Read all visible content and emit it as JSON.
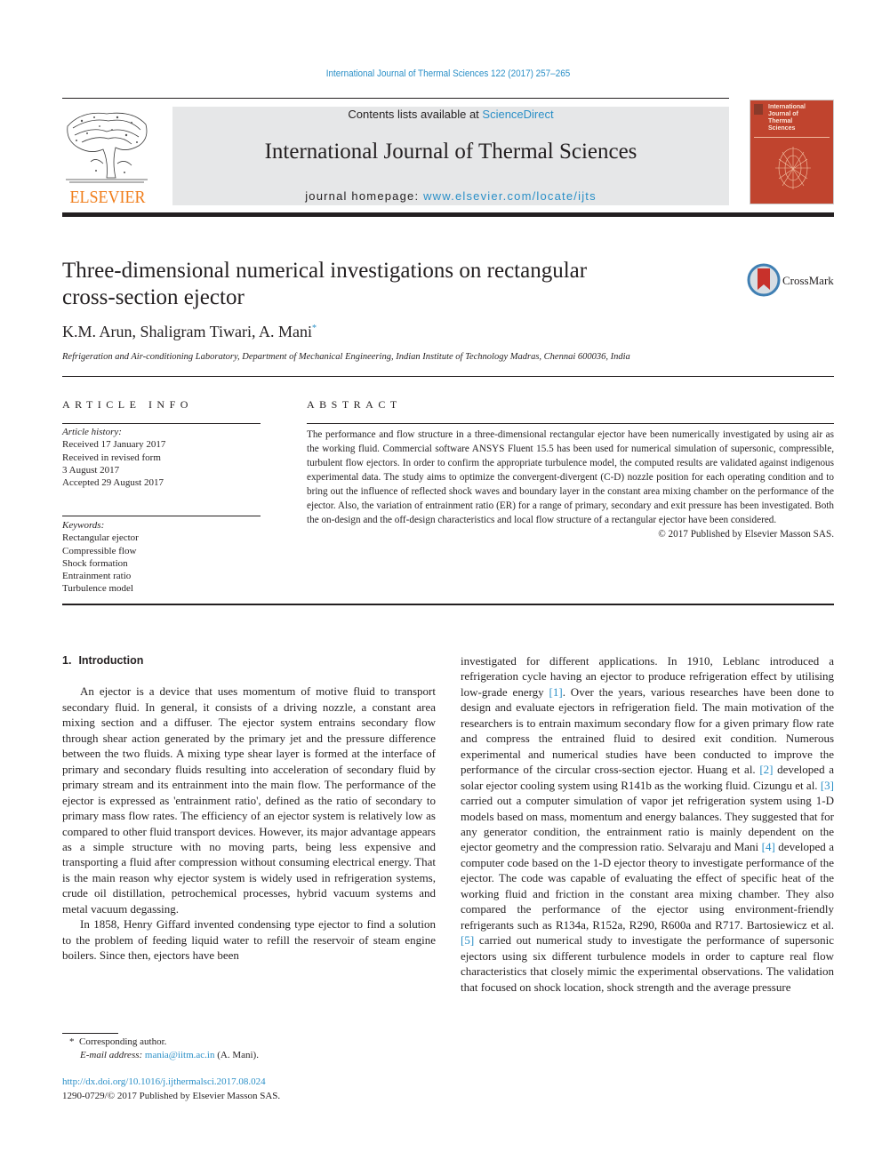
{
  "header": {
    "citation": "International Journal of Thermal Sciences 122 (2017) 257–265",
    "contents_prefix": "Contents lists available at ",
    "contents_link": "ScienceDirect",
    "journal_title": "International Journal of Thermal Sciences",
    "homepage_prefix": "journal homepage: ",
    "homepage_link": "www.elsevier.com/locate/ijts",
    "publisher_logo": "ELSEVIER",
    "cover_title_lines": [
      "International",
      "Journal of",
      "Thermal",
      "Sciences"
    ],
    "crossmark_label": "CrossMark"
  },
  "article": {
    "title_line1": "Three-dimensional numerical investigations on rectangular",
    "title_line2": "cross-section ejector",
    "authors": "K.M. Arun, Shaligram Tiwari, A. Mani",
    "corresponding_mark": "*",
    "affiliation": "Refrigeration and Air-conditioning Laboratory, Department of Mechanical Engineering, Indian Institute of Technology Madras, Chennai 600036, India"
  },
  "article_info": {
    "label": "ARTICLE INFO",
    "history_label": "Article history:",
    "history": [
      "Received 17 January 2017",
      "Received in revised form",
      "3 August 2017",
      "Accepted 29 August 2017"
    ],
    "keywords_label": "Keywords:",
    "keywords": [
      "Rectangular ejector",
      "Compressible flow",
      "Shock formation",
      "Entrainment ratio",
      "Turbulence model"
    ]
  },
  "abstract": {
    "label": "ABSTRACT",
    "text": "The performance and flow structure in a three-dimensional rectangular ejector have been numerically investigated by using air as the working fluid. Commercial software ANSYS Fluent 15.5 has been used for numerical simulation of supersonic, compressible, turbulent flow ejectors. In order to confirm the appropriate turbulence model, the computed results are validated against indigenous experimental data. The study aims to optimize the convergent-divergent (C-D) nozzle position for each operating condition and to bring out the influence of reflected shock waves and boundary layer in the constant area mixing chamber on the performance of the ejector. Also, the variation of entrainment ratio (ER) for a range of primary, secondary and exit pressure has been investigated. Both the on-design and the off-design characteristics and local flow structure of a rectangular ejector have been considered.",
    "copyright": "© 2017 Published by Elsevier Masson SAS."
  },
  "body": {
    "section_number": "1.",
    "section_title": "Introduction",
    "left_p1": "An ejector is a device that uses momentum of motive fluid to transport secondary fluid. In general, it consists of a driving nozzle, a constant area mixing section and a diffuser. The ejector system entrains secondary flow through shear action generated by the primary jet and the pressure difference between the two fluids. A mixing type shear layer is formed at the interface of primary and secondary fluids resulting into acceleration of secondary fluid by primary stream and its entrainment into the main flow. The performance of the ejector is expressed as 'entrainment ratio', defined as the ratio of secondary to primary mass flow rates. The efficiency of an ejector system is relatively low as compared to other fluid transport devices. However, its major advantage appears as a simple structure with no moving parts, being less expensive and transporting a fluid after compression without consuming electrical energy. That is the main reason why ejector system is widely used in refrigeration systems, crude oil distillation, petrochemical processes, hybrid vacuum systems and metal vacuum degassing.",
    "left_p2": "In 1858, Henry Giffard invented condensing type ejector to find a solution to the problem of feeding liquid water to refill the reservoir of steam engine boilers. Since then, ejectors have been",
    "right_seg1": "investigated for different applications. In 1910, Leblanc introduced a refrigeration cycle having an ejector to produce refrigeration effect by utilising low-grade energy ",
    "ref1": "[1]",
    "right_seg2": ". Over the years, various researches have been done to design and evaluate ejectors in refrigeration field. The main motivation of the researchers is to entrain maximum secondary flow for a given primary flow rate and compress the entrained fluid to desired exit condition. Numerous experimental and numerical studies have been conducted to improve the performance of the circular cross-section ejector. Huang et al. ",
    "ref2": "[2]",
    "right_seg3": " developed a solar ejector cooling system using R141b as the working fluid. Cizungu et al. ",
    "ref3": "[3]",
    "right_seg4": " carried out a computer simulation of vapor jet refrigeration system using 1-D models based on mass, momentum and energy balances. They suggested that for any generator condition, the entrainment ratio is mainly dependent on the ejector geometry and the compression ratio. Selvaraju and Mani ",
    "ref4": "[4]",
    "right_seg5": " developed a computer code based on the 1-D ejector theory to investigate performance of the ejector. The code was capable of evaluating the effect of specific heat of the working fluid and friction in the constant area mixing chamber. They also compared the performance of the ejector using environment-friendly refrigerants such as R134a, R152a, R290, R600a and R717. Bartosiewicz et al. ",
    "ref5": "[5]",
    "right_seg6": " carried out numerical study to investigate the performance of supersonic ejectors using six different turbulence models in order to capture real flow characteristics that closely mimic the experimental observations. The validation that focused on shock location, shock strength and the average pressure"
  },
  "footnote": {
    "mark": "*",
    "corresponding": "Corresponding author.",
    "email_label": "E-mail address:",
    "email": "mania@iitm.ac.in",
    "email_suffix": "(A. Mani)."
  },
  "doi": {
    "link": "http://dx.doi.org/10.1016/j.ijthermalsci.2017.08.024",
    "issn_line": "1290-0729/© 2017 Published by Elsevier Masson SAS."
  },
  "colors": {
    "link": "#2a8fc7",
    "elsevier_orange": "#f07d1a",
    "header_gray": "#e6e7e8",
    "cover_red": "#c0442e",
    "text": "#231f20"
  }
}
